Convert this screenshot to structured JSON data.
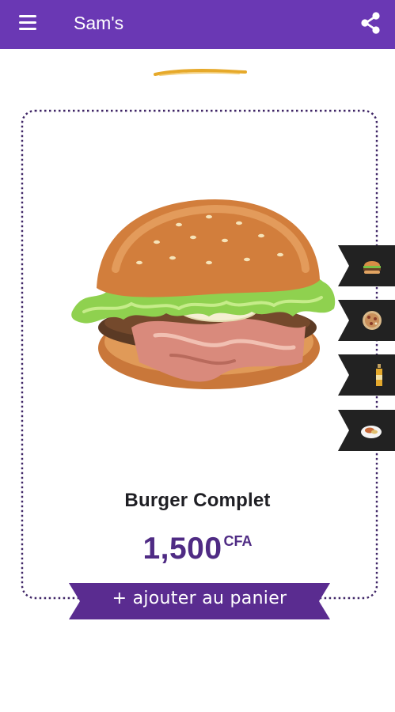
{
  "app": {
    "title": "Sam's",
    "menu_icon": "hamburger-menu-icon",
    "share_icon": "share-icon"
  },
  "product": {
    "name": "Burger Complet",
    "price": "1,500",
    "currency": "CFA",
    "image": "burger-image"
  },
  "actions": {
    "add_to_cart": "+ ajouter au panier"
  },
  "category_tabs": [
    {
      "icon": "burger-icon"
    },
    {
      "icon": "pizza-icon"
    },
    {
      "icon": "drink-bottle-icon"
    },
    {
      "icon": "plate-dish-icon"
    }
  ],
  "colors": {
    "primary": "#6a38b4",
    "price": "#4f2b84",
    "button": "#5a2c90",
    "tab_background": "#222222",
    "brush_accent": "#e6a92a"
  }
}
